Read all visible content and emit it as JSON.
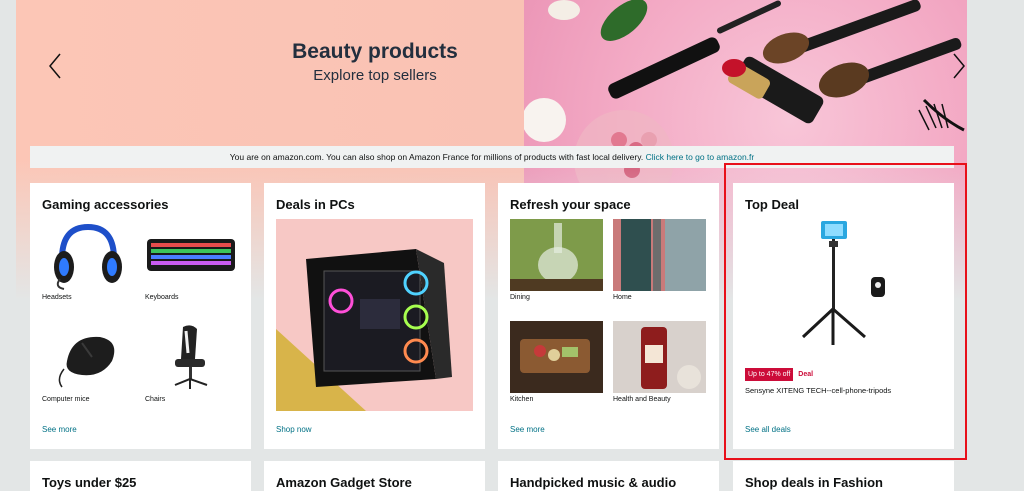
{
  "hero": {
    "title": "Beauty products",
    "subtitle": "Explore top sellers"
  },
  "notice": {
    "text": "You are on amazon.com. You can also shop on Amazon France for millions of products with fast local delivery. ",
    "link": "Click here to go to amazon.fr"
  },
  "cards": [
    {
      "title": "Gaming accessories",
      "items": [
        "Headsets",
        "Keyboards",
        "Computer mice",
        "Chairs"
      ],
      "link": "See more"
    },
    {
      "title": "Deals in PCs",
      "link": "Shop now"
    },
    {
      "title": "Refresh your space",
      "items": [
        "Dining",
        "Home",
        "Kitchen",
        "Health and Beauty"
      ],
      "link": "See more"
    },
    {
      "title": "Top Deal",
      "badge": "Up to 47% off",
      "badge_label": "Deal",
      "product": "Sensyne XITENG TECH--cell-phone-tripods",
      "link": "See all deals"
    }
  ],
  "row2": [
    "Toys under $25",
    "Amazon Gadget Store",
    "Handpicked music & audio",
    "Shop deals in Fashion"
  ],
  "colors": {
    "link": "#007185",
    "deal_red": "#cc0c39",
    "highlight_box": "#e8101a",
    "page_bg": "#e3e6e6"
  }
}
